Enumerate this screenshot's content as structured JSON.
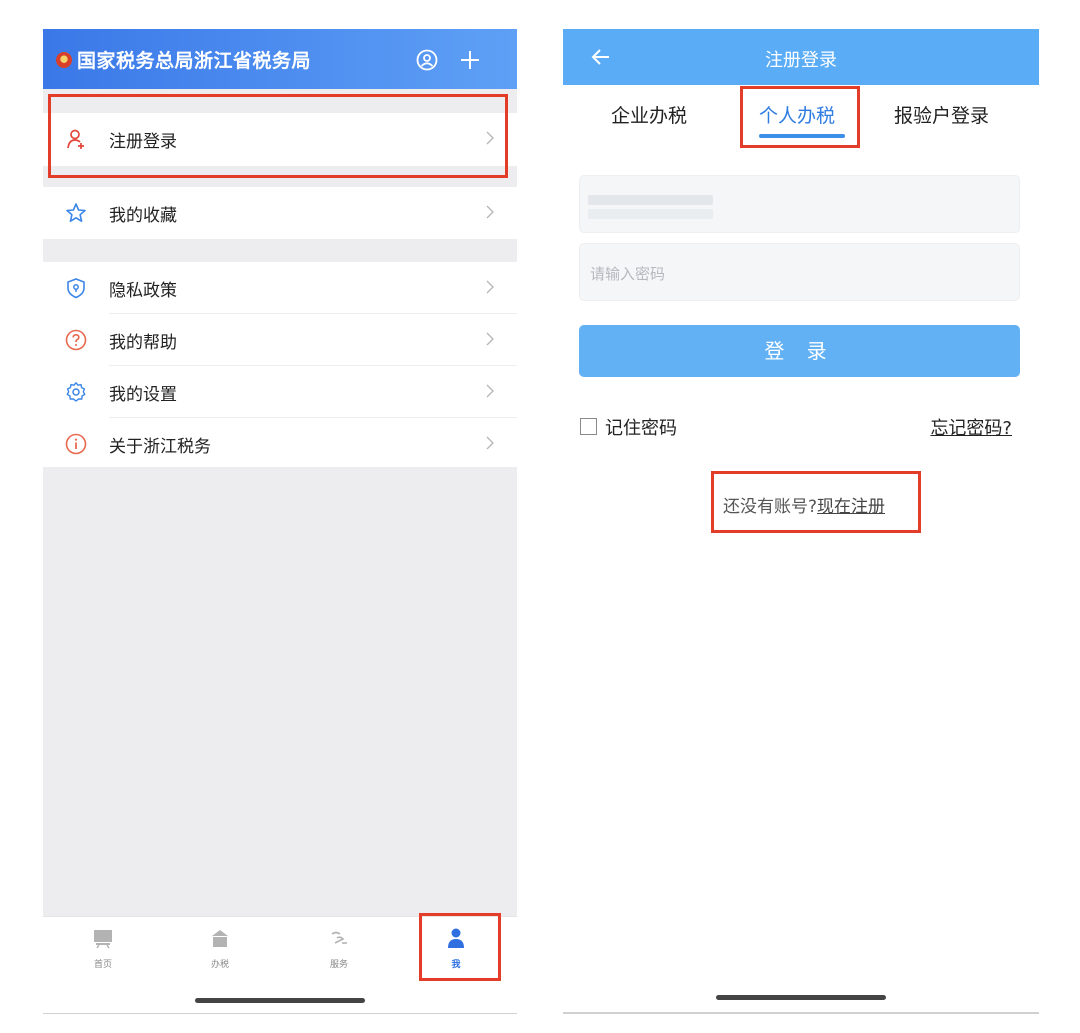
{
  "left": {
    "header": {
      "title": "国家税务总局浙江省税务局"
    },
    "menu": [
      {
        "label": "注册登录",
        "icon": "user-add-icon"
      },
      {
        "label": "我的收藏",
        "icon": "star-icon"
      },
      {
        "label": "隐私政策",
        "icon": "shield-icon"
      },
      {
        "label": "我的帮助",
        "icon": "question-icon"
      },
      {
        "label": "我的设置",
        "icon": "gear-icon"
      },
      {
        "label": "关于浙江税务",
        "icon": "info-icon"
      }
    ],
    "tabbar": [
      {
        "label": "首页",
        "icon": "home-screen-icon"
      },
      {
        "label": "办税",
        "icon": "building-icon"
      },
      {
        "label": "服务",
        "icon": "service-icon"
      },
      {
        "label": "我",
        "icon": "person-icon",
        "active": true
      }
    ]
  },
  "right": {
    "header": {
      "title": "注册登录"
    },
    "tabs": [
      {
        "label": "企业办税"
      },
      {
        "label": "个人办税",
        "active": true
      },
      {
        "label": "报验户登录"
      }
    ],
    "form": {
      "password_placeholder": "请输入密码",
      "login_label": "登 录",
      "remember_label": "记住密码",
      "forgot_label": "忘记密码?",
      "no_account_text": "还没有账号?",
      "register_link": "现在注册"
    }
  },
  "colors": {
    "accent_blue": "#5aacf7",
    "highlight_red": "#e33d2a"
  }
}
